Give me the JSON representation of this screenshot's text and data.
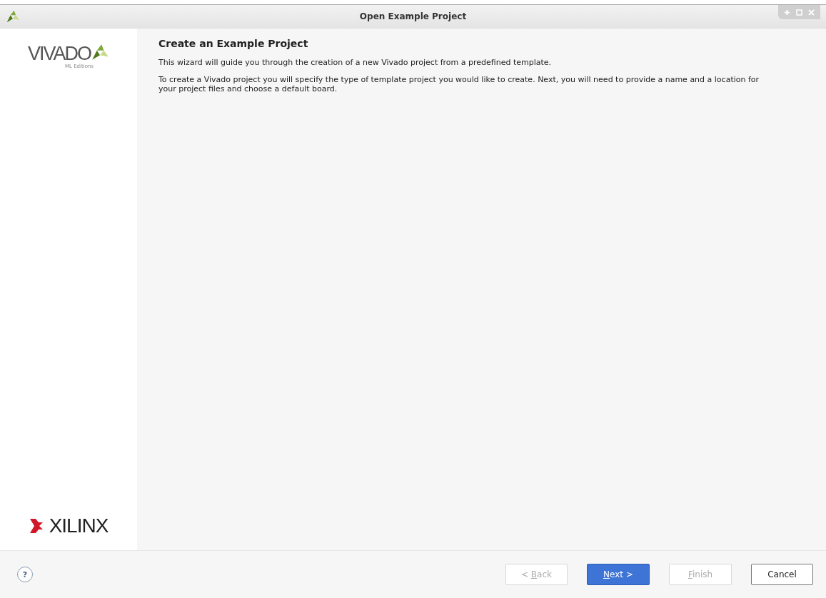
{
  "window": {
    "title": "Open Example Project"
  },
  "sidebar": {
    "product_logo": {
      "name": "VIVADO",
      "edition": "ML Editions"
    },
    "vendor_logo": {
      "name": "XILINX"
    }
  },
  "page": {
    "heading": "Create an Example Project",
    "paragraphs": [
      "This wizard will guide you through the creation of a new Vivado project from a predefined template.",
      "To create a Vivado project you will specify the type of template project you would like to create. Next, you will need to provide a name and a location for your project files and choose a default board."
    ]
  },
  "help": {
    "label": "?"
  },
  "buttons": [
    {
      "kind": "back",
      "before": "< ",
      "mnemonic": "B",
      "after": "ack",
      "disabled": true,
      "default": false
    },
    {
      "kind": "next",
      "mnemonic": "N",
      "after": "ext >",
      "disabled": false,
      "default": true
    },
    {
      "kind": "finish",
      "mnemonic": "F",
      "after": "inish",
      "disabled": true,
      "default": false
    },
    {
      "kind": "cancel",
      "label": "Cancel",
      "disabled": false,
      "default": false
    }
  ]
}
